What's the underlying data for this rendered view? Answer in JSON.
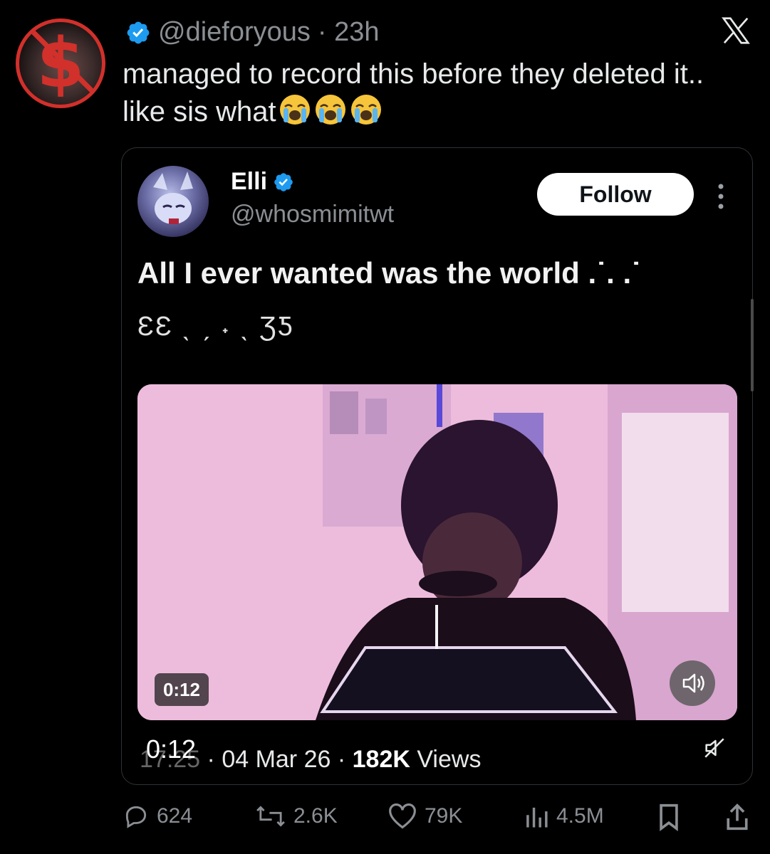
{
  "tweet": {
    "handle": "@dieforyous",
    "time": "· 23h",
    "text": "managed to record this before they deleted it.. like sis what",
    "emojis": [
      "loudly-crying-face",
      "loudly-crying-face",
      "loudly-crying-face"
    ]
  },
  "quote": {
    "name": "Elli",
    "handle": "@whosmimitwt",
    "follow_label": "Follow",
    "text": "All I ever wanted was the world .˙. .˙",
    "subtext": "ƐƐ ˎ ˏ ˖ ˎ ƷƼ",
    "video": {
      "duration_badge": "0:12",
      "overlay_time": "0:12"
    },
    "meta": {
      "time": "17:25",
      "date": "· 04 Mar 26 ·",
      "views_count": "182K",
      "views_label": "Views"
    }
  },
  "actions": {
    "replies": "624",
    "reposts": "2.6K",
    "likes": "79K",
    "views": "4.5M"
  },
  "colors": {
    "verified_blue": "#1d9bf0",
    "avatar_ring_red": "#d2302b",
    "muted_text": "#8b8f94"
  }
}
